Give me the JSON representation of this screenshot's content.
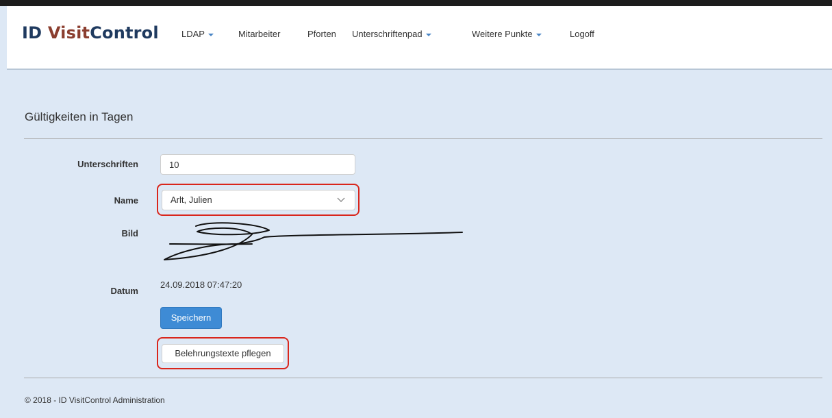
{
  "brand": {
    "part1": "ID ",
    "part2": "Visit",
    "part3": "Control"
  },
  "nav": {
    "ldap": "LDAP",
    "mitarbeiter": "Mitarbeiter",
    "pforten": "Pforten",
    "unterschriftenpad": "Unterschriftenpad",
    "weitere": "Weitere Punkte",
    "logoff": "Logoff"
  },
  "section_title": "Gültigkeiten in Tagen",
  "form": {
    "unterschriften_label": "Unterschriften",
    "unterschriften_value": "10",
    "name_label": "Name",
    "name_value": "Arlt, Julien",
    "bild_label": "Bild",
    "datum_label": "Datum",
    "datum_value": "24.09.2018 07:47:20"
  },
  "buttons": {
    "save": "Speichern",
    "manage_texts": "Belehrungstexte pflegen"
  },
  "footer": "© 2018 - ID VisitControl Administration",
  "colors": {
    "page_bg": "#dde8f5",
    "primary": "#3e8bd5",
    "highlight": "#d9261c",
    "brand_dark": "#1f3a5f",
    "brand_accent": "#8b3e2f"
  }
}
